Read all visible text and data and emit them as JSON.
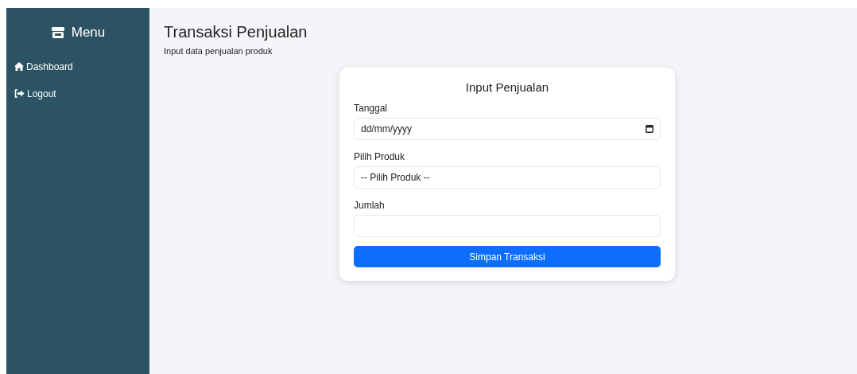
{
  "sidebar": {
    "title": "Menu",
    "items": [
      {
        "label": "Dashboard"
      },
      {
        "label": "Logout"
      }
    ]
  },
  "header": {
    "title": "Transaksi Penjualan",
    "subtitle": "Input data penjualan produk"
  },
  "form": {
    "title": "Input Penjualan",
    "fields": [
      {
        "kind": "date",
        "label": "Tanggal",
        "placeholder": "dd/mm/yyyy"
      },
      {
        "kind": "select",
        "label": "Pilih Produk",
        "value": "-- Pilih Produk --"
      },
      {
        "kind": "number",
        "label": "Jumlah"
      }
    ],
    "submit": "Simpan Transaksi"
  }
}
